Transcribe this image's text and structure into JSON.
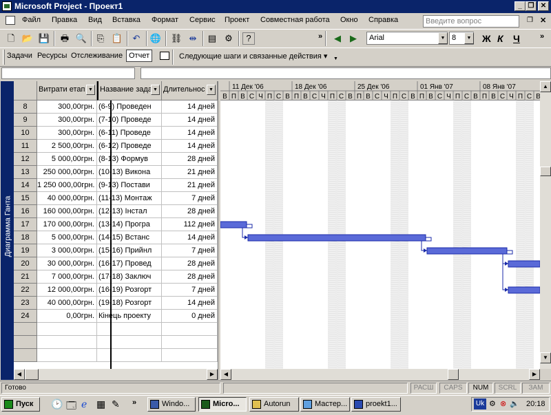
{
  "window": {
    "title": "Microsoft Project - Проект1"
  },
  "menu": [
    "Файл",
    "Правка",
    "Вид",
    "Вставка",
    "Формат",
    "Сервис",
    "Проект",
    "Совместная работа",
    "Окно",
    "Справка"
  ],
  "ask_placeholder": "Введите вопрос",
  "format": {
    "font": "Arial",
    "size": "8",
    "bold": "Ж",
    "italic": "К",
    "underline": "Ч"
  },
  "guide": {
    "items": [
      "Задачи",
      "Ресурсы",
      "Отслеживание",
      "Отчет"
    ],
    "next": "Следующие шаги и связанные действия"
  },
  "view_label": "Диаграмма Ганта",
  "columns": [
    "Витрати етап",
    "Название зада",
    "Длительнос"
  ],
  "rows": [
    {
      "id": "8",
      "cost": "300,00грн.",
      "name": "(6-9) Проведен",
      "dur": "14 дней"
    },
    {
      "id": "9",
      "cost": "300,00грн.",
      "name": "(7-10) Проведе",
      "dur": "14 дней"
    },
    {
      "id": "10",
      "cost": "300,00грн.",
      "name": "(6-11) Проведе",
      "dur": "14 дней"
    },
    {
      "id": "11",
      "cost": "2 500,00грн.",
      "name": "(6-12) Проведе",
      "dur": "14 дней"
    },
    {
      "id": "12",
      "cost": "5 000,00грн.",
      "name": "(8-13) Формув",
      "dur": "28 дней"
    },
    {
      "id": "13",
      "cost": "250 000,00грн.",
      "name": "(10-13) Викона",
      "dur": "21 дней"
    },
    {
      "id": "14",
      "cost": "1 250 000,00грн.",
      "name": "(9-13) Постави",
      "dur": "21 дней"
    },
    {
      "id": "15",
      "cost": "40 000,00грн.",
      "name": "(11-13) Монтаж",
      "dur": "7 дней"
    },
    {
      "id": "16",
      "cost": "160 000,00грн.",
      "name": "(12-13) Інстал",
      "dur": "28 дней"
    },
    {
      "id": "17",
      "cost": "170 000,00грн.",
      "name": "(13-14) Програ",
      "dur": "112 дней"
    },
    {
      "id": "18",
      "cost": "5 000,00грн.",
      "name": "(14-15) Встанс",
      "dur": "14 дней"
    },
    {
      "id": "19",
      "cost": "3 000,00грн.",
      "name": "(15-16) Прийнл",
      "dur": "7 дней"
    },
    {
      "id": "20",
      "cost": "30 000,00грн.",
      "name": "(16-17) Провед",
      "dur": "28 дней"
    },
    {
      "id": "21",
      "cost": "7 000,00грн.",
      "name": "(17-18) Заключ",
      "dur": "28 дней"
    },
    {
      "id": "22",
      "cost": "12 000,00грн.",
      "name": "(16-19) Розгорт",
      "dur": "7 дней"
    },
    {
      "id": "23",
      "cost": "40 000,00грн.",
      "name": "(19-18) Розгорт",
      "dur": "14 дней"
    },
    {
      "id": "24",
      "cost": "0,00грн.",
      "name": "Кінець проекту",
      "dur": "0 дней"
    }
  ],
  "gantt": {
    "weeks": [
      "11 Дек '06",
      "18 Дек '06",
      "25 Дек '06",
      "01 Янв '07",
      "08 Янв '07"
    ],
    "days": [
      "В",
      "П",
      "В",
      "С",
      "Ч",
      "П",
      "С"
    ]
  },
  "status": {
    "ready": "Готово",
    "indicators": [
      "РАСШ",
      "CAPS",
      "NUM",
      "SCRL",
      "ЗАМ"
    ]
  },
  "taskbar": {
    "start": "Пуск",
    "buttons": [
      "Windo...",
      "Micro...",
      "Autorun",
      "Мастер...",
      "proekt1..."
    ],
    "lang": "Uk",
    "clock": "20:18"
  }
}
